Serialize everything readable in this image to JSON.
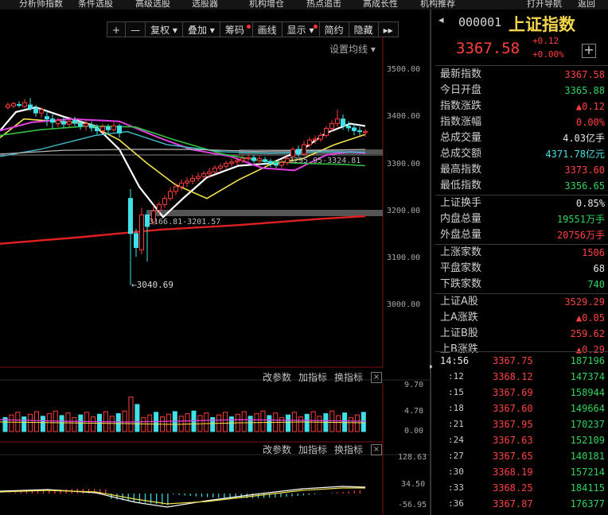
{
  "top_menu": [
    "分析师指数",
    "条件选股",
    "高级选股",
    "选股器",
    "机构增仓",
    "热点追击",
    "高成长性",
    "机构推荐",
    "打开导航",
    "返回"
  ],
  "toolbar": {
    "plus": "+",
    "minus": "—",
    "fuquan": "复权",
    "overlay": "叠加",
    "chips": "筹码",
    "draw": "画线",
    "display": "显示",
    "simple": "简约",
    "hide": "隐藏",
    "next": "▸▸"
  },
  "chart": {
    "ma_setting": "设置均线",
    "y_ticks": [
      "3500.00",
      "3400.00",
      "3300.00",
      "3200.00",
      "3100.00",
      "3000.00"
    ],
    "low_label": "←3040.69",
    "range_label_1": "3166.81-3201.57",
    "range_label_2": "3295.95-3324.81",
    "panel1": {
      "edit": "改参数",
      "add": "加指标",
      "switch": "换指标",
      "close": "×",
      "y_ticks": [
        "9.70",
        "4.78",
        "0.00"
      ]
    },
    "panel2": {
      "edit": "改参数",
      "add": "加指标",
      "switch": "换指标",
      "close": "×",
      "y_ticks": [
        "128.63",
        "34.50",
        "-56.95"
      ]
    }
  },
  "chart_data": {
    "type": "candlestick",
    "ylim": [
      2960,
      3540
    ],
    "y_ticks": [
      3500,
      3400,
      3300,
      3200,
      3100,
      3000
    ],
    "low_annotation": 3040.69,
    "volume_ylim": [
      0,
      9.7
    ],
    "volume_ticks": [
      9.7,
      4.78,
      0.0
    ],
    "macd_ylim": [
      -56.95,
      128.63
    ],
    "macd_ticks": [
      128.63,
      34.5,
      -56.95
    ]
  },
  "quote": {
    "code": "000001",
    "name": "上证指数",
    "price": "3367.58",
    "change": "+0.12",
    "change_pct": "+0.00%",
    "add_btn": "+",
    "fields": [
      {
        "label": "最新指数",
        "value": "3367.58",
        "color": "red"
      },
      {
        "label": "今日开盘",
        "value": "3365.88",
        "color": "green"
      },
      {
        "label": "指数涨跌",
        "value": "▲0.12",
        "color": "red"
      },
      {
        "label": "指数涨幅",
        "value": "0.00%",
        "color": "red"
      },
      {
        "label": "总成交量",
        "value": "4.03亿手",
        "color": "white"
      },
      {
        "label": "总成交额",
        "value": "4371.78亿元",
        "color": "cyan"
      },
      {
        "label": "最高指数",
        "value": "3373.60",
        "color": "red"
      },
      {
        "label": "最低指数",
        "value": "3356.65",
        "color": "green"
      },
      {
        "label": "上证换手",
        "value": "0.85%",
        "color": "white"
      },
      {
        "label": "内盘总量",
        "value": "19551万手",
        "color": "green"
      },
      {
        "label": "外盘总量",
        "value": "20756万手",
        "color": "red"
      },
      {
        "label": "上涨家数",
        "value": "1506",
        "color": "red"
      },
      {
        "label": "平盘家数",
        "value": "68",
        "color": "white"
      },
      {
        "label": "下跌家数",
        "value": "740",
        "color": "green"
      },
      {
        "label": "上证A股",
        "value": "3529.29",
        "color": "red"
      },
      {
        "label": "上A涨跌",
        "value": "▲0.05",
        "color": "red"
      },
      {
        "label": "上证B股",
        "value": "259.62",
        "color": "red"
      },
      {
        "label": "上B涨跌",
        "value": "▲0.29",
        "color": "red"
      }
    ],
    "ticks": [
      {
        "time": "14:56",
        "price": "3367.75",
        "vol": "187196"
      },
      {
        "time": ":12",
        "price": "3368.12",
        "vol": "147374"
      },
      {
        "time": ":15",
        "price": "3367.69",
        "vol": "158944"
      },
      {
        "time": ":18",
        "price": "3367.60",
        "vol": "149664"
      },
      {
        "time": ":21",
        "price": "3367.95",
        "vol": "170237"
      },
      {
        "time": ":24",
        "price": "3367.63",
        "vol": "152109"
      },
      {
        "time": ":27",
        "price": "3367.65",
        "vol": "140181"
      },
      {
        "time": ":30",
        "price": "3368.19",
        "vol": "157214"
      },
      {
        "time": ":33",
        "price": "3368.25",
        "vol": "184115"
      },
      {
        "time": ":36",
        "price": "3367.87",
        "vol": "176377"
      }
    ]
  }
}
